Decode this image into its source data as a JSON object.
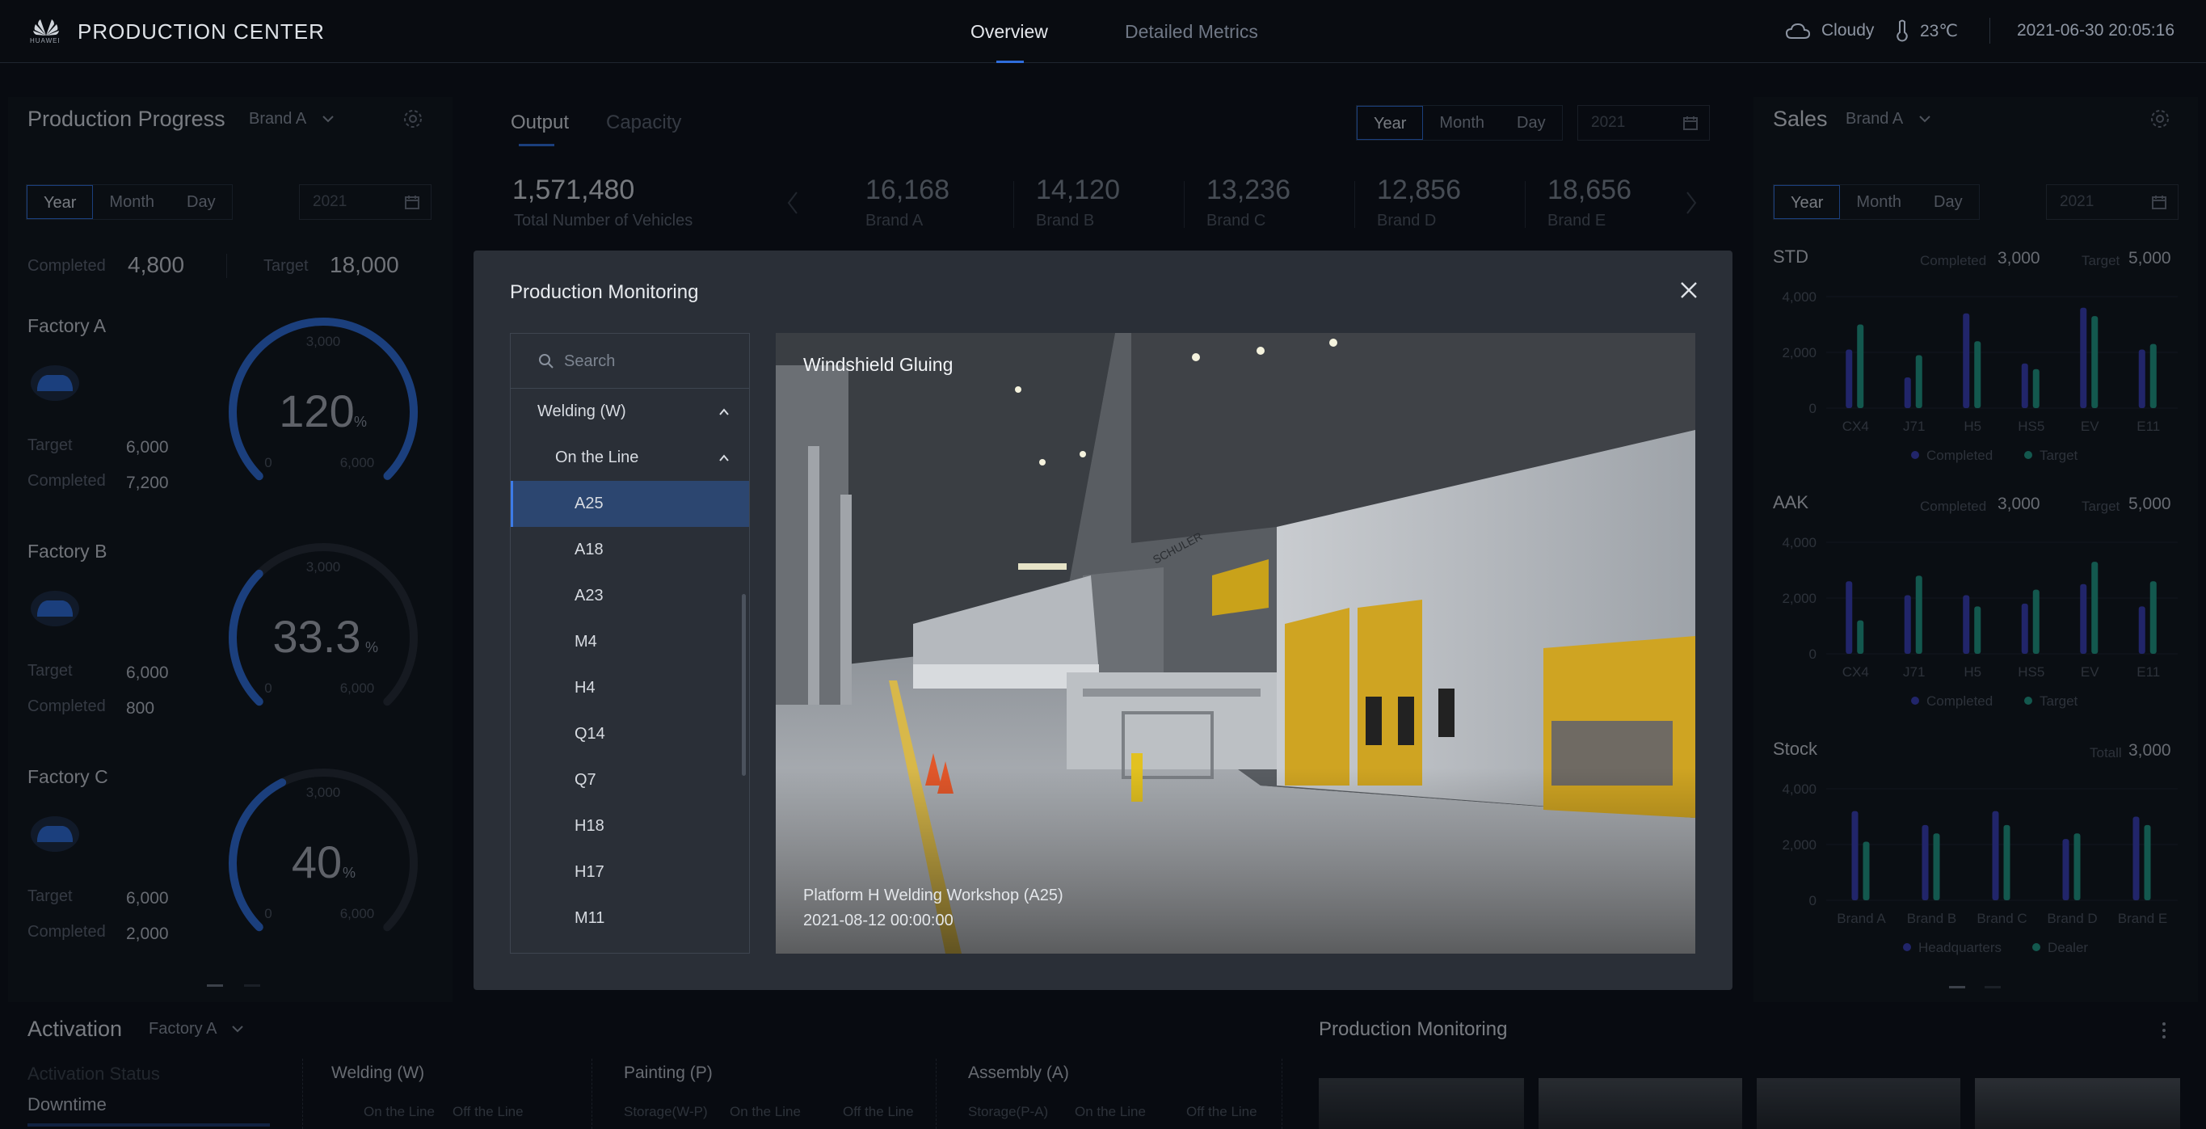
{
  "header": {
    "brand": "PRODUCTION CENTER",
    "logo_text": "HUAWEI",
    "tabs": [
      {
        "label": "Overview",
        "active": true
      },
      {
        "label": "Detailed Metrics",
        "active": false
      }
    ],
    "weather": "Cloudy",
    "temperature": "23℃",
    "datetime": "2021-06-30 20:05:16"
  },
  "progress": {
    "title": "Production Progress",
    "brand_select": "Brand A",
    "periods": [
      "Year",
      "Month",
      "Day"
    ],
    "active_period": "Year",
    "year": "2021",
    "completed_label": "Completed",
    "completed": "4,800",
    "target_label": "Target",
    "target": "18,000",
    "factories": [
      {
        "name": "Factory A",
        "percent": "120",
        "unit": "%",
        "scale_top": "3,000",
        "scale_min": "0",
        "scale_max": "6,000",
        "target_label": "Target",
        "target": "6,000",
        "completed_label": "Completed",
        "completed": "7,200",
        "fill": 1.0
      },
      {
        "name": "Factory B",
        "percent": "33.3",
        "unit": "%",
        "scale_top": "3,000",
        "scale_min": "0",
        "scale_max": "6,000",
        "target_label": "Target",
        "target": "6,000",
        "completed_label": "Completed",
        "completed": "800",
        "fill": 0.333
      },
      {
        "name": "Factory C",
        "percent": "40",
        "unit": "%",
        "scale_top": "3,000",
        "scale_min": "0",
        "scale_max": "6,000",
        "target_label": "Target",
        "target": "6,000",
        "completed_label": "Completed",
        "completed": "2,000",
        "fill": 0.4
      }
    ]
  },
  "output": {
    "tabs": [
      "Output",
      "Capacity"
    ],
    "active_tab": "Output",
    "periods": [
      "Year",
      "Month",
      "Day"
    ],
    "active_period": "Year",
    "year": "2021",
    "total": "1,571,480",
    "total_label": "Total Number of Vehicles",
    "brands": [
      {
        "value": "16,168",
        "label": "Brand A"
      },
      {
        "value": "14,120",
        "label": "Brand B"
      },
      {
        "value": "13,236",
        "label": "Brand C"
      },
      {
        "value": "12,856",
        "label": "Brand D"
      },
      {
        "value": "18,656",
        "label": "Brand E"
      }
    ]
  },
  "sales": {
    "title": "Sales",
    "brand_select": "Brand A",
    "periods": [
      "Year",
      "Month",
      "Day"
    ],
    "active_period": "Year",
    "year": "2021",
    "colors": {
      "completed": "#3a3fb8",
      "target": "#1f9c86"
    }
  },
  "chart_data": [
    {
      "type": "bar",
      "title": "STD",
      "completed_label": "Completed",
      "completed": "3,000",
      "target_label": "Target",
      "target": "5,000",
      "categories": [
        "CX4",
        "J71",
        "H5",
        "HS5",
        "EV",
        "E11"
      ],
      "ylim": [
        0,
        4000
      ],
      "yticks": [
        "0",
        "2,000",
        "4,000"
      ],
      "series": [
        {
          "name": "Completed",
          "values": [
            2100,
            1100,
            3400,
            1600,
            3600,
            2100
          ]
        },
        {
          "name": "Target",
          "values": [
            3000,
            1900,
            2400,
            1400,
            3300,
            2300
          ]
        }
      ]
    },
    {
      "type": "bar",
      "title": "AAK",
      "completed_label": "Completed",
      "completed": "3,000",
      "target_label": "Target",
      "target": "5,000",
      "categories": [
        "CX4",
        "J71",
        "H5",
        "HS5",
        "EV",
        "E11"
      ],
      "ylim": [
        0,
        4000
      ],
      "yticks": [
        "0",
        "2,000",
        "4,000"
      ],
      "series": [
        {
          "name": "Completed",
          "values": [
            2600,
            2100,
            2100,
            1800,
            2500,
            1700
          ]
        },
        {
          "name": "Target",
          "values": [
            1200,
            2800,
            1700,
            2300,
            3300,
            2600
          ]
        }
      ]
    },
    {
      "type": "bar",
      "title": "Stock",
      "completed_label": "Totall",
      "completed": "3,000",
      "categories": [
        "Brand A",
        "Brand B",
        "Brand C",
        "Brand D",
        "Brand E"
      ],
      "ylim": [
        0,
        4000
      ],
      "yticks": [
        "0",
        "2,000",
        "4,000"
      ],
      "series": [
        {
          "name": "Headquarters",
          "values": [
            3200,
            2700,
            3200,
            2200,
            3000
          ]
        },
        {
          "name": "Dealer",
          "values": [
            2100,
            2400,
            2700,
            2400,
            2700
          ]
        }
      ]
    }
  ],
  "activation": {
    "title": "Activation",
    "factory_select": "Factory A",
    "status_label": "Activation Status",
    "downtime_label": "Downtime",
    "groups": [
      {
        "name": "Welding (W)",
        "cols": [
          "On the Line",
          "Off the Line"
        ]
      },
      {
        "name": "Painting (P)",
        "cols": [
          "Storage(W-P)",
          "On the Line",
          "Off the Line"
        ]
      },
      {
        "name": "Assembly (A)",
        "cols": [
          "Storage(P-A)",
          "On the Line",
          "Off the Line"
        ]
      }
    ]
  },
  "monitoring": {
    "title": "Production Monitoring"
  },
  "modal": {
    "title": "Production Monitoring",
    "search_placeholder": "Search",
    "tree": {
      "group": "Welding (W)",
      "subgroup": "On the Line",
      "items": [
        "A25",
        "A18",
        "A23",
        "M4",
        "H4",
        "Q14",
        "Q7",
        "H18",
        "H17",
        "M11"
      ],
      "selected": "A25"
    },
    "photo": {
      "title": "Windshield Gluing",
      "caption": "Platform H Welding Workshop (A25)",
      "timestamp": "2021-08-12 00:00:00",
      "machine_label": "SCHULER"
    }
  }
}
